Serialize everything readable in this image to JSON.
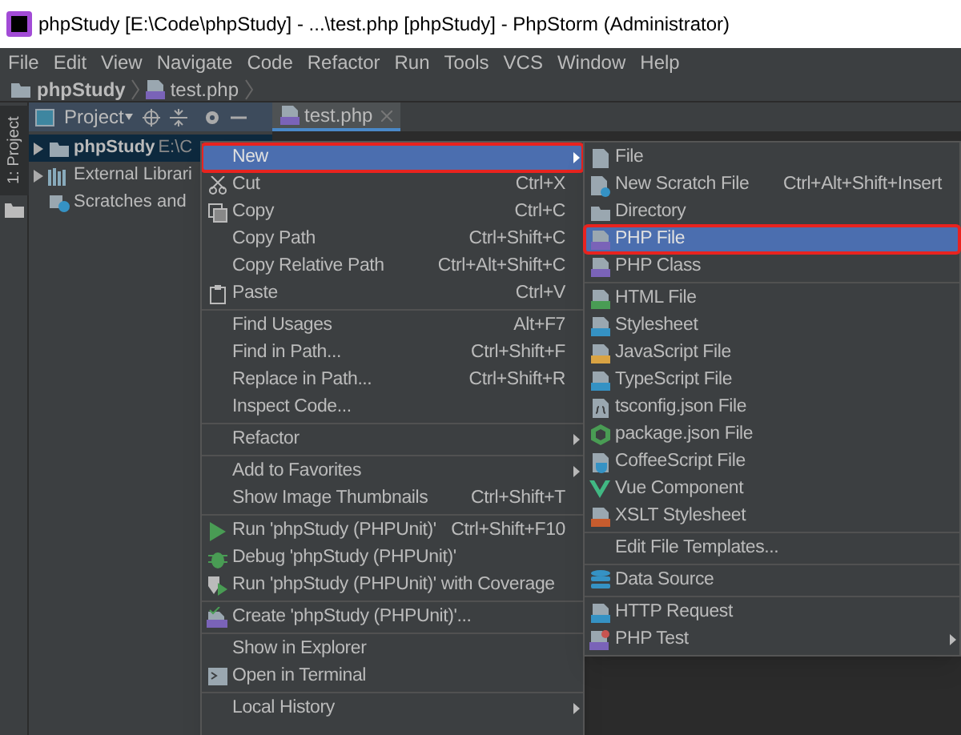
{
  "window": {
    "title": "phpStudy [E:\\Code\\phpStudy] - ...\\test.php [phpStudy] - PhpStorm (Administrator)"
  },
  "menu_bar": [
    "File",
    "Edit",
    "View",
    "Navigate",
    "Code",
    "Refactor",
    "Run",
    "Tools",
    "VCS",
    "Window",
    "Help"
  ],
  "breadcrumbs": [
    "phpStudy",
    "test.php"
  ],
  "tool_window": {
    "title": "Project",
    "side_label": "1: Project"
  },
  "editor_tabs": [
    {
      "label": "test.php",
      "selected": true
    }
  ],
  "project_tree": [
    {
      "label": "phpStudy",
      "path": "E:\\C",
      "expanded": false,
      "selected": true
    },
    {
      "label": "External Librari",
      "expanded": false,
      "selected": false
    },
    {
      "label": "Scratches and",
      "selected": false
    }
  ],
  "context_menu": [
    {
      "kind": "item",
      "label": "New",
      "submenu": true,
      "selected": true,
      "outlined": true
    },
    {
      "kind": "item",
      "label": "Cut",
      "shortcut": "Ctrl+X",
      "selected": false
    },
    {
      "kind": "item",
      "label": "Copy",
      "shortcut": "Ctrl+C",
      "selected": false
    },
    {
      "kind": "item",
      "label": "Copy Path",
      "shortcut": "Ctrl+Shift+C",
      "selected": false
    },
    {
      "kind": "item",
      "label": "Copy Relative Path",
      "shortcut": "Ctrl+Alt+Shift+C",
      "selected": false
    },
    {
      "kind": "item",
      "label": "Paste",
      "shortcut": "Ctrl+V",
      "selected": false
    },
    {
      "kind": "separator"
    },
    {
      "kind": "item",
      "label": "Find Usages",
      "shortcut": "Alt+F7",
      "selected": false
    },
    {
      "kind": "item",
      "label": "Find in Path...",
      "shortcut": "Ctrl+Shift+F",
      "selected": false
    },
    {
      "kind": "item",
      "label": "Replace in Path...",
      "shortcut": "Ctrl+Shift+R",
      "selected": false
    },
    {
      "kind": "item",
      "label": "Inspect Code...",
      "selected": false
    },
    {
      "kind": "separator"
    },
    {
      "kind": "item",
      "label": "Refactor",
      "submenu": true,
      "selected": false
    },
    {
      "kind": "separator"
    },
    {
      "kind": "item",
      "label": "Add to Favorites",
      "submenu": true,
      "selected": false
    },
    {
      "kind": "item",
      "label": "Show Image Thumbnails",
      "shortcut": "Ctrl+Shift+T",
      "selected": false
    },
    {
      "kind": "separator"
    },
    {
      "kind": "item",
      "label": "Run 'phpStudy (PHPUnit)'",
      "shortcut": "Ctrl+Shift+F10",
      "selected": false
    },
    {
      "kind": "item",
      "label": "Debug 'phpStudy (PHPUnit)'",
      "selected": false
    },
    {
      "kind": "item",
      "label": "Run 'phpStudy (PHPUnit)' with Coverage",
      "selected": false
    },
    {
      "kind": "separator"
    },
    {
      "kind": "item",
      "label": "Create 'phpStudy (PHPUnit)'...",
      "selected": false
    },
    {
      "kind": "separator"
    },
    {
      "kind": "item",
      "label": "Show in Explorer",
      "selected": false
    },
    {
      "kind": "item",
      "label": "Open in Terminal",
      "selected": false
    },
    {
      "kind": "separator"
    },
    {
      "kind": "item",
      "label": "Local History",
      "submenu": true,
      "selected": false
    }
  ],
  "new_submenu": [
    {
      "kind": "item",
      "label": "File",
      "selected": false
    },
    {
      "kind": "item",
      "label": "New Scratch File",
      "shortcut": "Ctrl+Alt+Shift+Insert",
      "selected": false
    },
    {
      "kind": "item",
      "label": "Directory",
      "selected": false
    },
    {
      "kind": "item",
      "label": "PHP File",
      "selected": true,
      "outlined": true
    },
    {
      "kind": "item",
      "label": "PHP Class",
      "selected": false
    },
    {
      "kind": "separator"
    },
    {
      "kind": "item",
      "label": "HTML File",
      "selected": false
    },
    {
      "kind": "item",
      "label": "Stylesheet",
      "selected": false
    },
    {
      "kind": "item",
      "label": "JavaScript File",
      "selected": false
    },
    {
      "kind": "item",
      "label": "TypeScript File",
      "selected": false
    },
    {
      "kind": "item",
      "label": "tsconfig.json File",
      "selected": false
    },
    {
      "kind": "item",
      "label": "package.json File",
      "selected": false
    },
    {
      "kind": "item",
      "label": "CoffeeScript File",
      "selected": false
    },
    {
      "kind": "item",
      "label": "Vue Component",
      "selected": false
    },
    {
      "kind": "item",
      "label": "XSLT Stylesheet",
      "selected": false
    },
    {
      "kind": "separator"
    },
    {
      "kind": "item",
      "label": "Edit File Templates...",
      "selected": false
    },
    {
      "kind": "separator"
    },
    {
      "kind": "item",
      "label": "Data Source",
      "selected": false
    },
    {
      "kind": "separator"
    },
    {
      "kind": "item",
      "label": "HTTP Request",
      "selected": false
    },
    {
      "kind": "item",
      "label": "PHP Test",
      "submenu": true,
      "selected": false
    }
  ]
}
